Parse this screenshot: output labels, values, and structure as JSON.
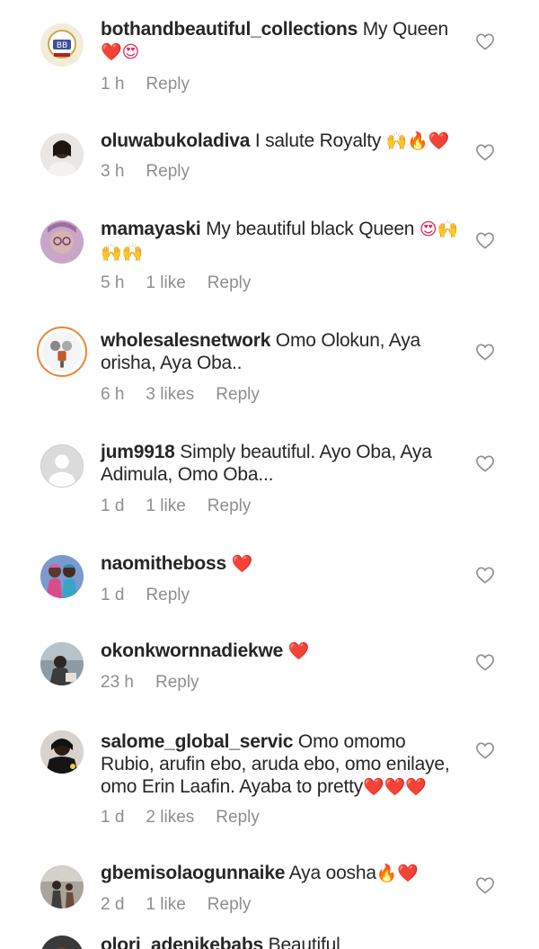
{
  "comments": [
    {
      "username": "bothandbeautiful_collections",
      "text": " My Queen",
      "emoji": "❤️😍",
      "time": "1 h",
      "likes": "",
      "reply": "Reply"
    },
    {
      "username": "oluwabukoladiva",
      "text": " I salute Royalty ",
      "emoji": "🙌🔥❤️",
      "time": "3 h",
      "likes": "",
      "reply": "Reply"
    },
    {
      "username": "mamayaski",
      "text": " My beautiful black Queen ",
      "emoji": "😍🙌🙌🙌",
      "time": "5 h",
      "likes": "1 like",
      "reply": "Reply"
    },
    {
      "username": "wholesalesnetwork",
      "text": " Omo Olokun, Aya orisha, Aya Oba..",
      "emoji": "",
      "time": "6 h",
      "likes": "3 likes",
      "reply": "Reply"
    },
    {
      "username": "jum9918",
      "text": " Simply beautiful. Ayo Oba, Aya Adimula, Omo Oba...",
      "emoji": "",
      "time": "1 d",
      "likes": "1 like",
      "reply": "Reply"
    },
    {
      "username": "naomitheboss",
      "text": " ",
      "emoji": "❤️",
      "time": "1 d",
      "likes": "",
      "reply": "Reply"
    },
    {
      "username": "okonkwornnadiekwe",
      "text": " ",
      "emoji": "❤️",
      "time": "23 h",
      "likes": "",
      "reply": "Reply"
    },
    {
      "username": "salome_global_servic",
      "text": " Omo omomo Rubio, arufin ebo, aruda ebo, omo enilaye, omo Erin Laafin. Ayaba to pretty",
      "emoji": "❤️❤️❤️",
      "time": "1 d",
      "likes": "2 likes",
      "reply": "Reply"
    },
    {
      "username": "gbemisolaogunnaike",
      "text": " Aya oosha",
      "emoji": "🔥❤️",
      "time": "2 d",
      "likes": "1 like",
      "reply": "Reply"
    },
    {
      "username": "olori_adenikebabs",
      "text": " Beautiful",
      "emoji": "",
      "time": "",
      "likes": "",
      "reply": ""
    }
  ],
  "colors": {
    "text": "#262626",
    "meta": "#8e8e8e",
    "heart_outline": "#8e8e8e",
    "emoji_heart": "#e0245e"
  }
}
